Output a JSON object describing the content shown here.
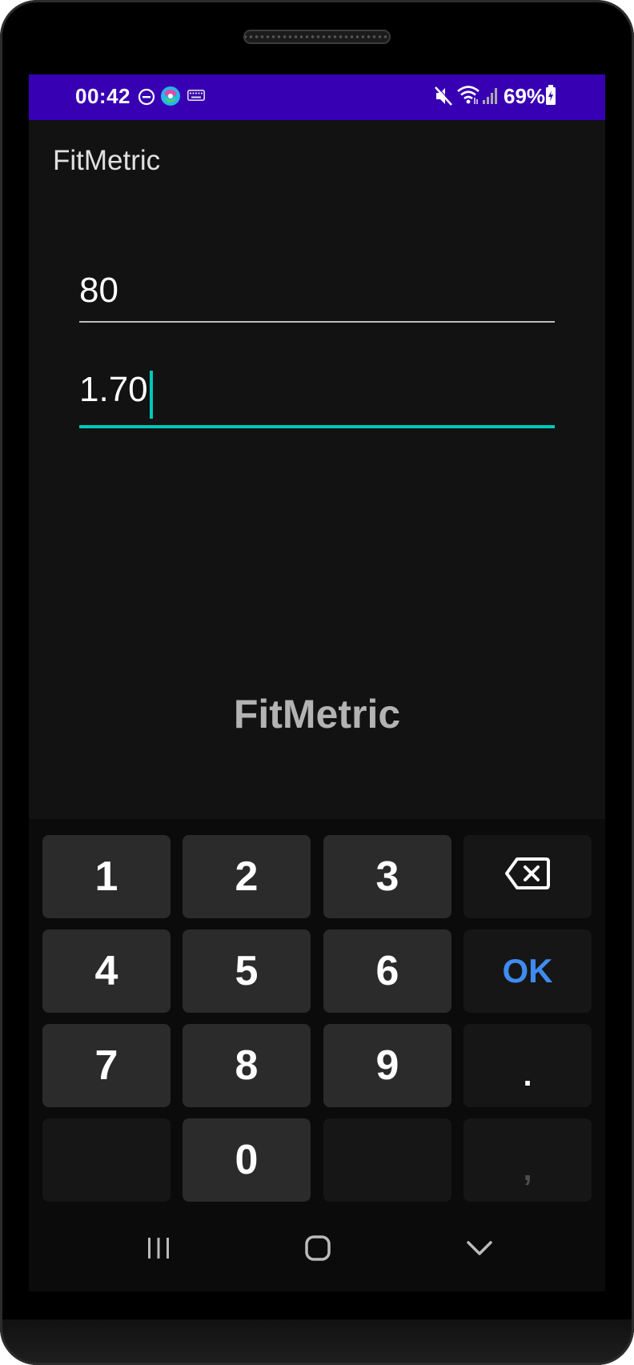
{
  "status_bar": {
    "time": "00:42",
    "battery_percent": "69%",
    "background_color": "#3700b3",
    "icons_left": [
      "do-not-disturb-icon",
      "app-notification-icon",
      "keyboard-icon"
    ],
    "icons_right": [
      "mute-icon",
      "wifi-icon",
      "signal-icon",
      "battery-charging-icon"
    ]
  },
  "app_bar": {
    "title": "FitMetric"
  },
  "form": {
    "weight_value": "80",
    "height_value": "1.70",
    "focused_field": "height",
    "accent_color": "#00c8b8"
  },
  "center_label": "FitMetric",
  "keyboard": {
    "row1": [
      "1",
      "2",
      "3"
    ],
    "row2": [
      "4",
      "5",
      "6"
    ],
    "row3": [
      "7",
      "8",
      "9"
    ],
    "zero": "0",
    "ok_label": "OK",
    "dot_label": ".",
    "comma_label": ",",
    "backspace_icon": "backspace-icon",
    "ok_color": "#3f8cf1"
  },
  "nav_bar": {
    "icons": [
      "recent-apps-icon",
      "home-icon",
      "back-icon"
    ]
  }
}
